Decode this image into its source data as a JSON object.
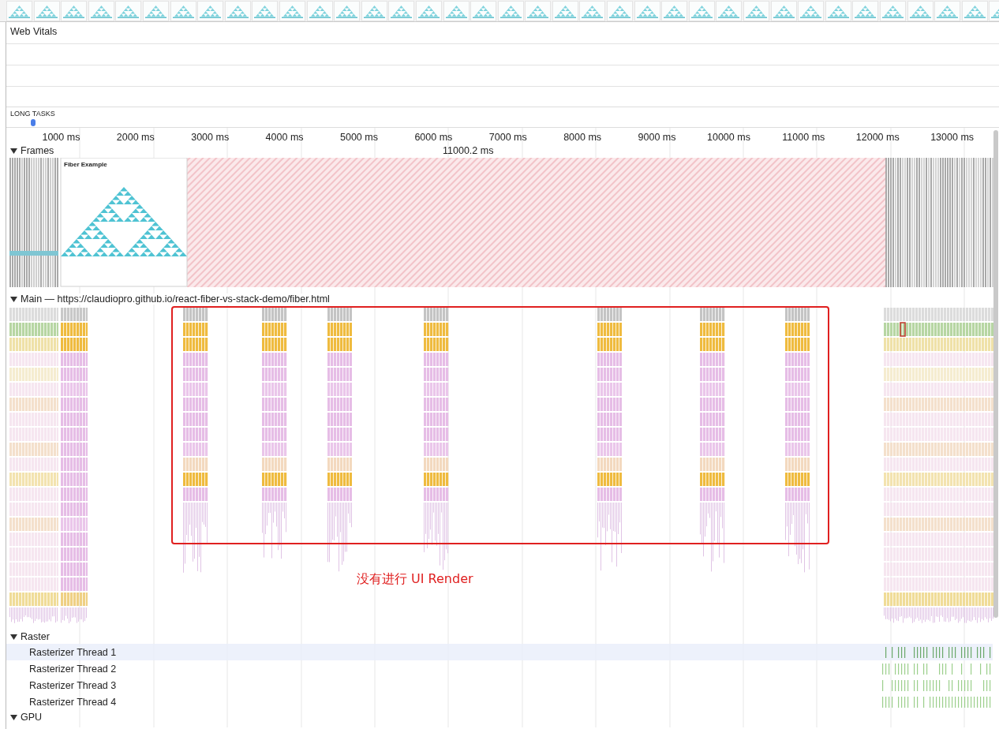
{
  "tracks": {
    "web_vitals": "Web Vitals",
    "long_tasks": "LONG TASKS"
  },
  "ruler": {
    "ticks": [
      "1000 ms",
      "2000 ms",
      "3000 ms",
      "4000 ms",
      "5000 ms",
      "6000 ms",
      "7000 ms",
      "8000 ms",
      "9000 ms",
      "10000 ms",
      "11000 ms",
      "12000 ms",
      "13000 ms"
    ]
  },
  "frames": {
    "label": "Frames",
    "expanded": true,
    "span": "11000.2 ms",
    "thumbnail_title": "Fiber Example"
  },
  "main": {
    "label": "Main — https://claudiopro.github.io/react-fiber-vs-stack-demo/fiber.html",
    "expanded": true
  },
  "annotation": "没有进行 UI Render",
  "raster": {
    "label": "Raster",
    "expanded": true,
    "threads": [
      {
        "label": "Rasterizer Thread 1",
        "selected": true
      },
      {
        "label": "Rasterizer Thread 2",
        "selected": false
      },
      {
        "label": "Rasterizer Thread 3",
        "selected": false
      },
      {
        "label": "Rasterizer Thread 4",
        "selected": false
      }
    ]
  },
  "gpu": {
    "label": "GPU",
    "expanded": true
  }
}
